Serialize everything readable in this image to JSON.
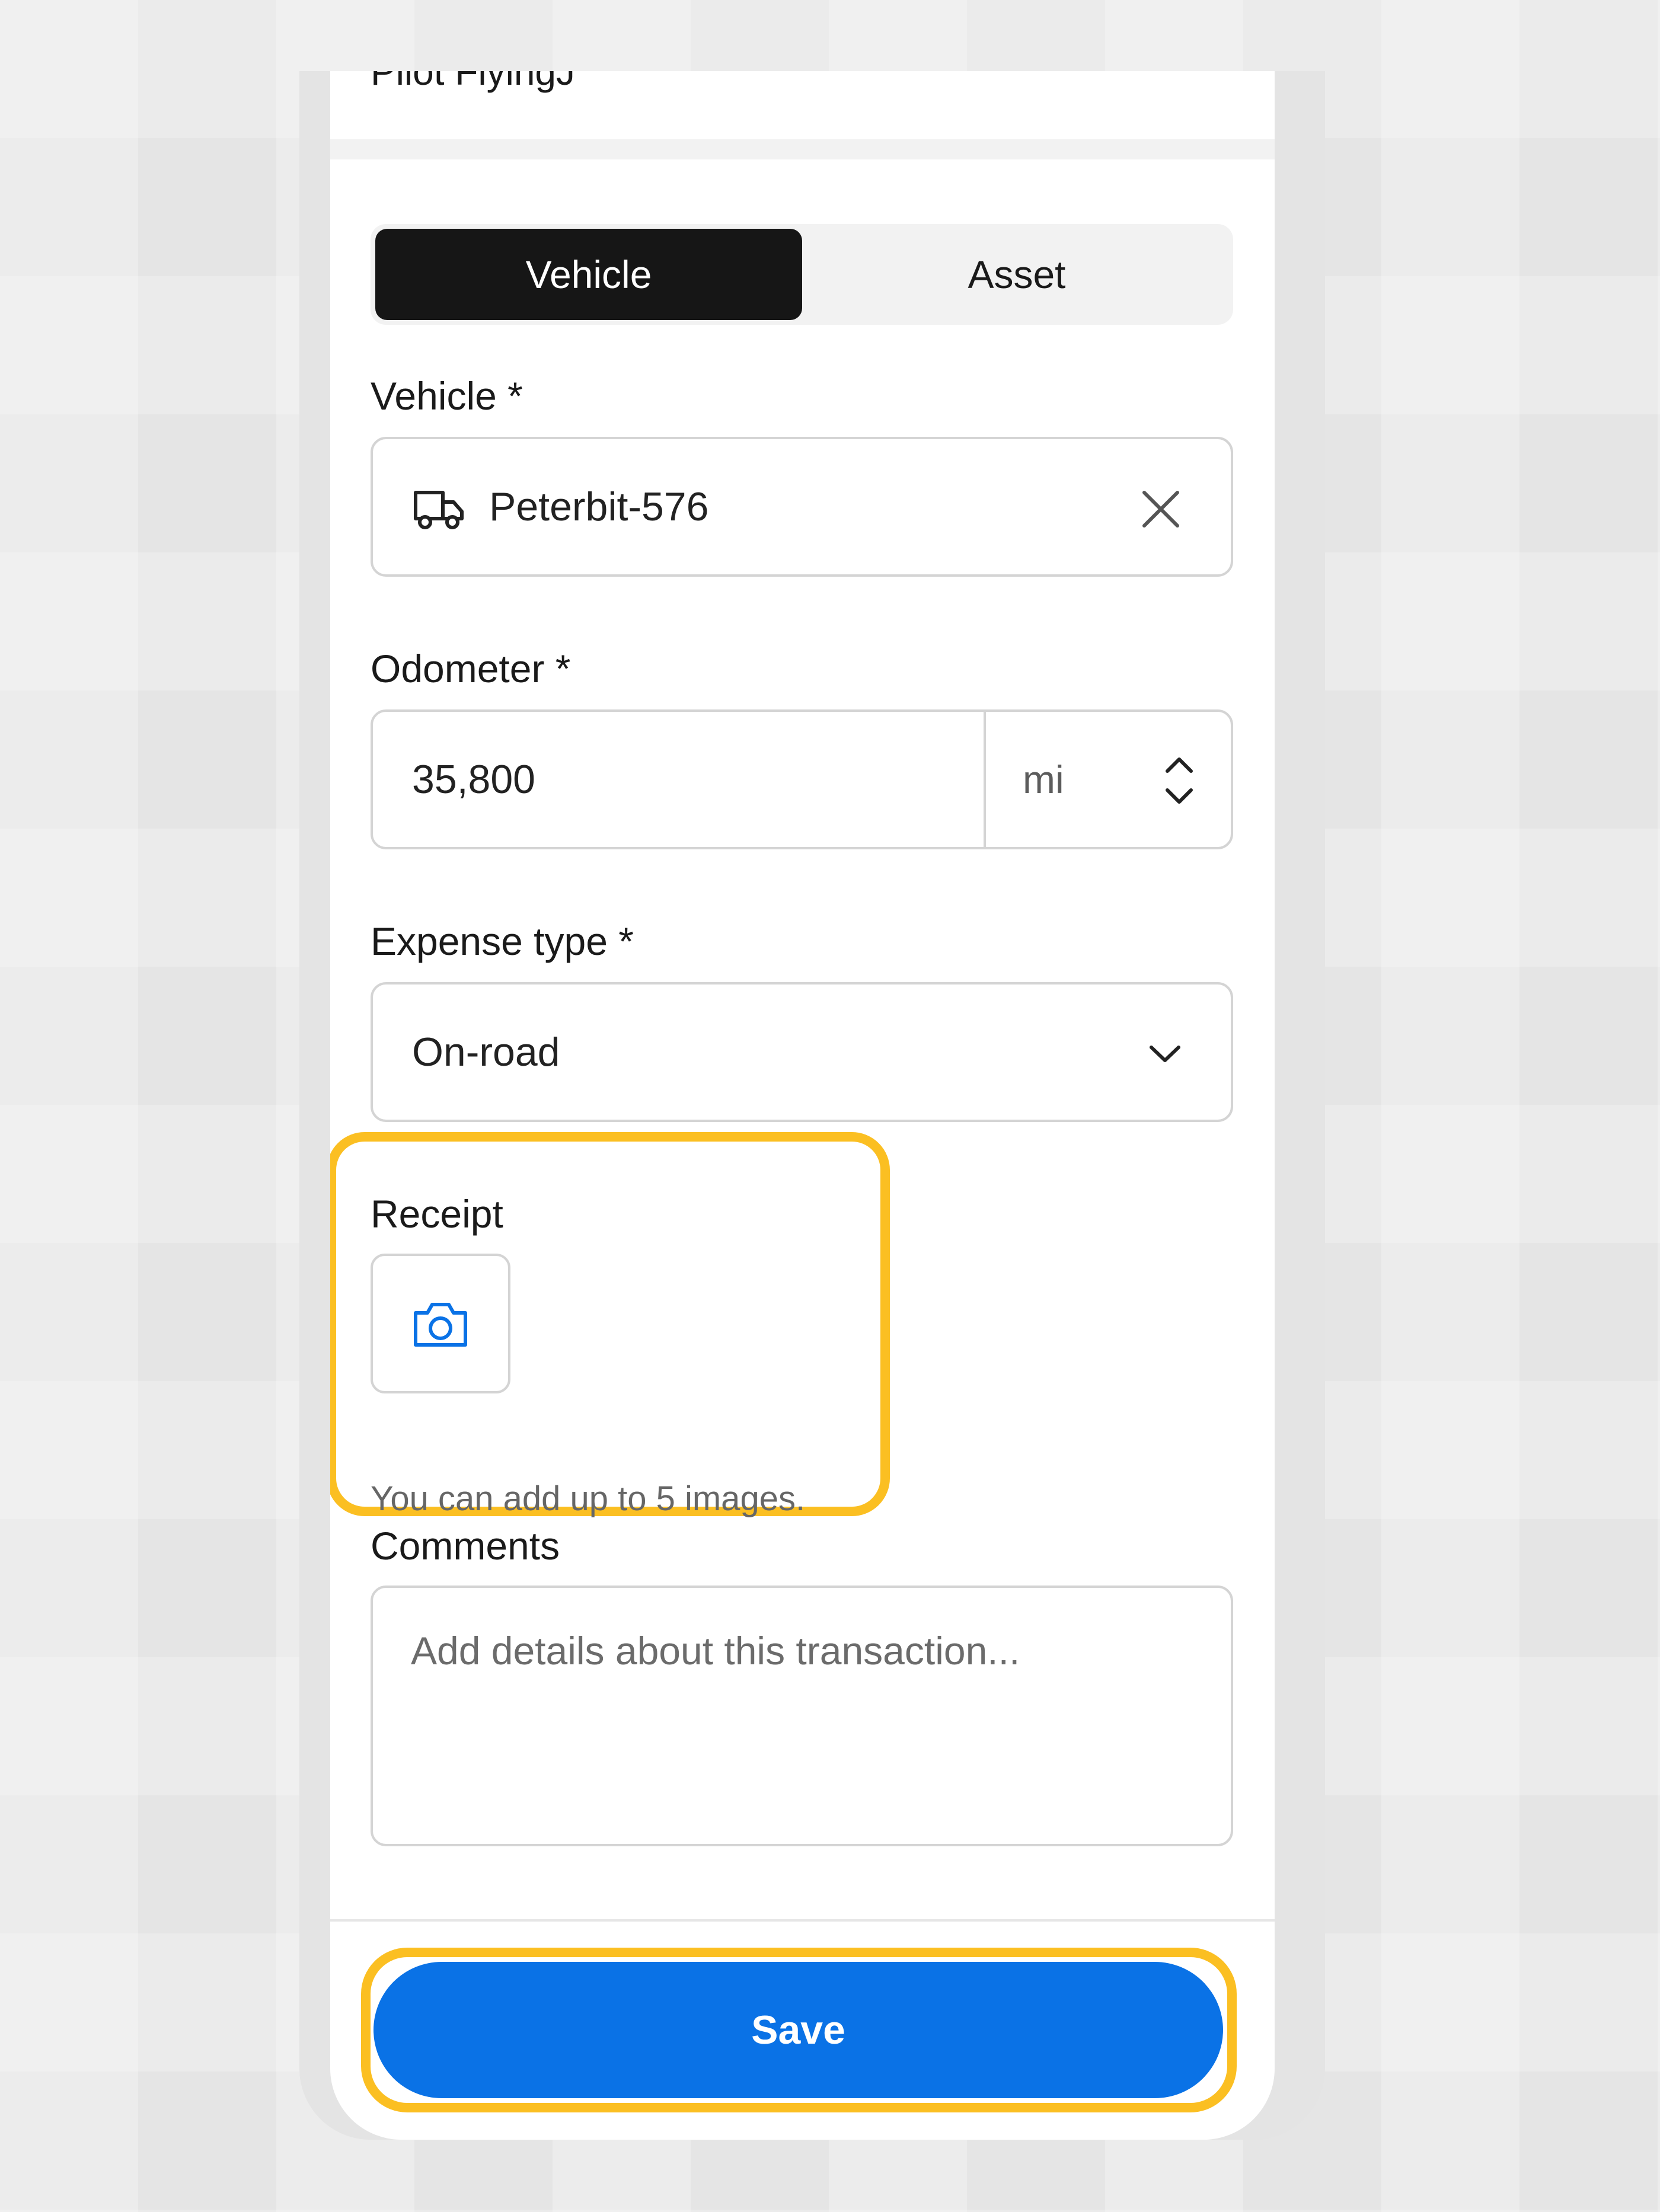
{
  "header": {
    "previous_title": "Pilot FlyingJ"
  },
  "segmented": {
    "vehicle_label": "Vehicle",
    "asset_label": "Asset",
    "selected": "Vehicle"
  },
  "vehicle": {
    "label": "Vehicle *",
    "value": "Peterbit-576",
    "icon": "truck-icon",
    "clear_icon": "close-icon"
  },
  "odometer": {
    "label": "Odometer *",
    "value": "35,800",
    "unit": "mi",
    "unit_icon": "chevron-up-down-icon"
  },
  "expense_type": {
    "label": "Expense type *",
    "value": "On-road",
    "icon": "chevron-down-icon"
  },
  "receipt": {
    "label": "Receipt",
    "icon": "camera-icon",
    "hint": "You can add up to 5 images."
  },
  "comments": {
    "label": "Comments",
    "placeholder": "Add details about this transaction..."
  },
  "footer": {
    "save_label": "Save"
  },
  "colors": {
    "accent": "#0a72e6",
    "highlight": "#fbbf22",
    "segment_active": "#161616"
  }
}
